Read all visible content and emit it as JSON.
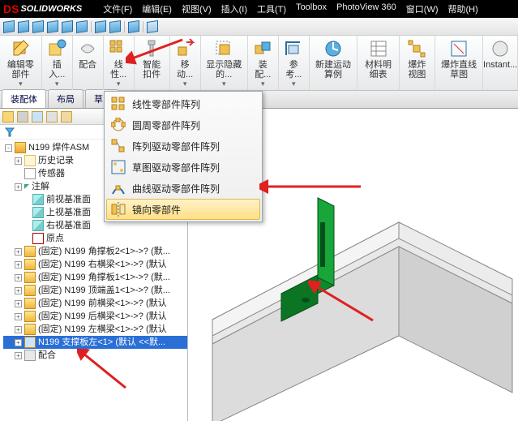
{
  "app": {
    "name": "SOLIDWORKS"
  },
  "menus": [
    "文件(F)",
    "编辑(E)",
    "视图(V)",
    "插入(I)",
    "工具(T)",
    "Toolbox",
    "PhotoView 360",
    "窗口(W)",
    "帮助(H)"
  ],
  "ribbon": [
    {
      "label": "编辑零部件"
    },
    {
      "label": "插入..."
    },
    {
      "label": "配合"
    },
    {
      "label": "线性..."
    },
    {
      "label": "智能扣件"
    },
    {
      "label": "移动..."
    },
    {
      "label": "显示隐藏的..."
    },
    {
      "label": "装配..."
    },
    {
      "label": "参考..."
    },
    {
      "label": "新建运动算例"
    },
    {
      "label": "材料明细表"
    },
    {
      "label": "爆炸视图"
    },
    {
      "label": "爆炸直线草图"
    },
    {
      "label": "Instant..."
    }
  ],
  "tabs": [
    "装配体",
    "布局",
    "草..."
  ],
  "dropdown": [
    "线性零部件阵列",
    "圆周零部件阵列",
    "阵列驱动零部件阵列",
    "草图驱动零部件阵列",
    "曲线驱动零部件阵列",
    "镜向零部件"
  ],
  "tree": {
    "root": "N199 焊件ASM",
    "history": "历史记录",
    "sensors": "传感器",
    "notes": "注解",
    "planes": [
      "前视基准面",
      "上视基准面",
      "右视基准面"
    ],
    "origin": "原点",
    "parts": [
      "(固定) N199 角撑板2<1>->? (默...",
      "(固定) N199 右横梁<1>->? (默认",
      "(固定) N199 角撑板1<1>->? (默...",
      "(固定) N199 顶端盖1<1>->? (默...",
      "(固定) N199 前横梁<1>->? (默认",
      "(固定) N199 后横梁<1>->? (默认",
      "(固定) N199 左横梁<1>->? (默认"
    ],
    "selected": "N199 支撑板左<1> (默认 <<默...",
    "mates": "配合"
  }
}
